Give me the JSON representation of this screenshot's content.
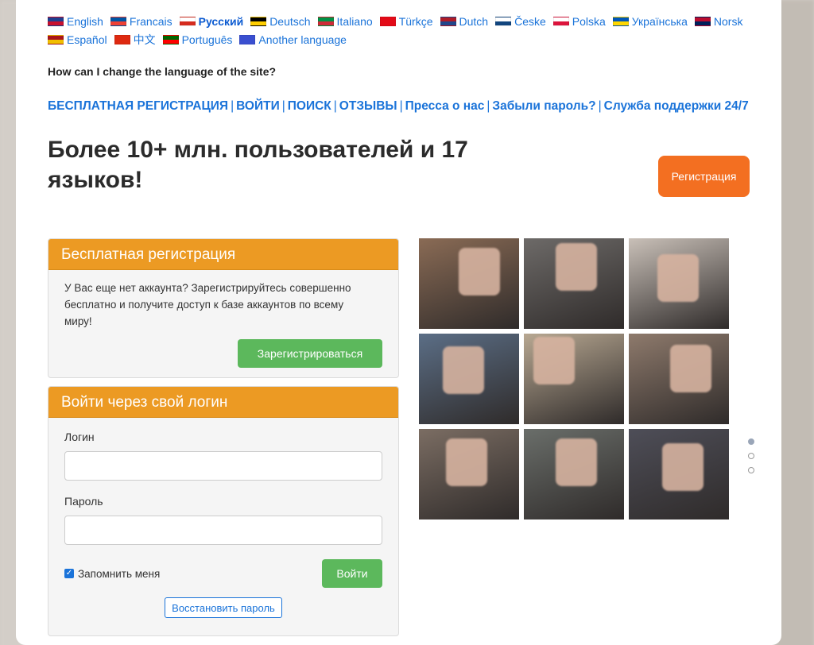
{
  "languages": [
    {
      "label": "English",
      "flag": [
        "#1f3f8f",
        "#c8102e"
      ]
    },
    {
      "label": "Francais",
      "flag": [
        "#0055a4",
        "#ef4135"
      ]
    },
    {
      "label": "Русский",
      "flag": [
        "#ffffff",
        "#d52b1e"
      ],
      "active": true
    },
    {
      "label": "Deutsch",
      "flag": [
        "#000000",
        "#ffce00"
      ]
    },
    {
      "label": "Italiano",
      "flag": [
        "#009246",
        "#ce2b37"
      ]
    },
    {
      "label": "Türkçe",
      "flag": [
        "#e30a17",
        "#e30a17"
      ]
    },
    {
      "label": "Dutch",
      "flag": [
        "#ae1c28",
        "#21468b"
      ]
    },
    {
      "label": "Česke",
      "flag": [
        "#ffffff",
        "#11457e"
      ]
    },
    {
      "label": "Polska",
      "flag": [
        "#ffffff",
        "#dc143c"
      ]
    },
    {
      "label": "Українська",
      "flag": [
        "#0057b7",
        "#ffd700"
      ]
    },
    {
      "label": "Norsk",
      "flag": [
        "#ba0c2f",
        "#00205b"
      ]
    },
    {
      "label": "Español",
      "flag": [
        "#aa151b",
        "#f1bf00"
      ]
    },
    {
      "label": "中文",
      "flag": [
        "#de2910",
        "#de2910"
      ]
    },
    {
      "label": "Português",
      "flag": [
        "#006600",
        "#ff0000"
      ]
    },
    {
      "label": "Another language",
      "flag": [
        "#3a4fd0",
        "#3a4fd0"
      ]
    }
  ],
  "question": "How can I change the language of the site?",
  "nav_links": [
    "БЕСПЛАТНАЯ РЕГИСТРАЦИЯ",
    "ВОЙТИ",
    "ПОИСК",
    "ОТЗЫВЫ",
    "Пресса о нас",
    "Забыли пароль?",
    "Служба поддержки 24/7"
  ],
  "hero": {
    "title": "Более 10+ млн. пользователей и 17 языков!",
    "register_button": "Регистрация"
  },
  "register_panel": {
    "title": "Бесплатная регистрация",
    "text": "У Вас еще нет аккаунта? Зарегистрируйтесь совершенно бесплатно и получите доступ к базе аккаунтов по всему миру!",
    "button": "Зарегистрироваться"
  },
  "login_panel": {
    "title": "Войти через свой логин",
    "login_label": "Логин",
    "password_label": "Пароль",
    "remember_label": "Запомнить меня",
    "remember_checked": true,
    "submit_button": "Войти",
    "restore_button": "Восстановить пароль"
  },
  "gallery": {
    "photo_count": 9,
    "colors": [
      "#8a6b55",
      "#6d6a68",
      "#c9c0b8",
      "#5b6e86",
      "#b8a892",
      "#8e7a6c",
      "#7b6d63",
      "#6a6e6a",
      "#4e4e58"
    ],
    "active_slide": 1,
    "slides": 3
  },
  "colors": {
    "accent_orange": "#ec9a23",
    "button_orange": "#f36f21",
    "button_green": "#5cb85c",
    "link_blue": "#1a73d9"
  }
}
